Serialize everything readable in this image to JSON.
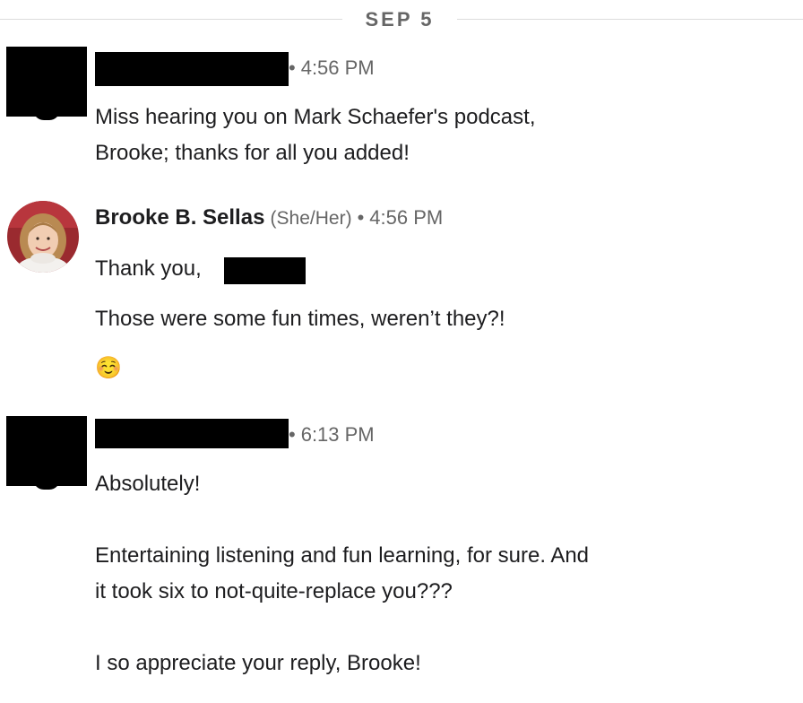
{
  "date_divider": "SEP 5",
  "messages": [
    {
      "sender_redacted": true,
      "time": "4:56 PM",
      "lines": [
        "Miss hearing you on Mark Schaefer's podcast,",
        "Brooke; thanks for all you added!"
      ]
    },
    {
      "sender_name": "Brooke B. Sellas",
      "pronouns": "(She/Her)",
      "time": "4:56 PM",
      "greeting": "Thank you,",
      "line2": "Those were some fun times, weren’t they?!",
      "emoji": "☺️"
    },
    {
      "sender_redacted": true,
      "time": "6:13 PM",
      "lines": [
        "Absolutely!",
        "Entertaining listening and fun learning, for sure. And",
        "it took six to not-quite-replace you???",
        "I so appreciate your reply, Brooke!"
      ]
    }
  ],
  "separator": "•"
}
